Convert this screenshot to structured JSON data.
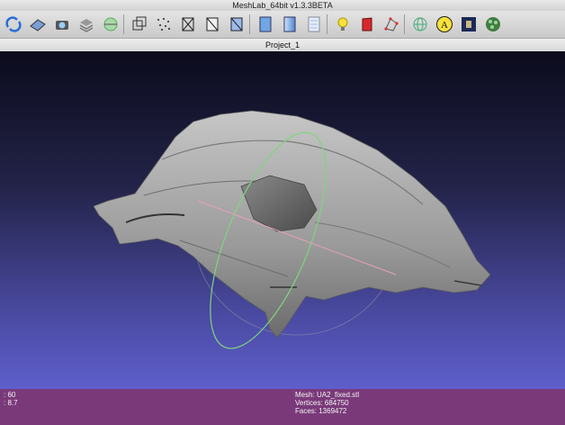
{
  "window": {
    "title": "MeshLab_64bit v1.3.3BETA"
  },
  "toolbar": {
    "buttons": [
      {
        "name": "open-project-icon"
      },
      {
        "name": "import-mesh-icon"
      },
      {
        "name": "snapshot-icon"
      },
      {
        "name": "layers-icon"
      },
      {
        "name": "decorations-icon"
      },
      {
        "name": "bounding-box-icon"
      },
      {
        "name": "points-icon"
      },
      {
        "name": "wireframe-icon"
      },
      {
        "name": "hidden-lines-icon"
      },
      {
        "name": "flat-lines-icon"
      },
      {
        "name": "flat-shading-icon"
      },
      {
        "name": "smooth-shading-icon"
      },
      {
        "name": "texture-icon"
      },
      {
        "name": "light-bulb-icon"
      },
      {
        "name": "color-mode-icon"
      },
      {
        "name": "select-vertices-icon"
      },
      {
        "name": "globe-icon"
      },
      {
        "name": "annotate-icon"
      },
      {
        "name": "paint-icon"
      },
      {
        "name": "shader-icon"
      }
    ],
    "annotate_glyph": "A"
  },
  "tab": {
    "label": "Project_1"
  },
  "status": {
    "left_line1": ": 60",
    "left_line2": ":    8.7",
    "mesh_line": "Mesh: UA2_fixed.stl",
    "vertices_line": "Vertices: 684750",
    "faces_line": "Faces: 1369472"
  },
  "colors": {
    "accent_status": "#7a3a7a",
    "viewport_top": "#0b0b1c",
    "viewport_bottom": "#5e5ecc",
    "trackball_green": "#7dd67d",
    "mesh_grey": "#9c9c9c"
  }
}
